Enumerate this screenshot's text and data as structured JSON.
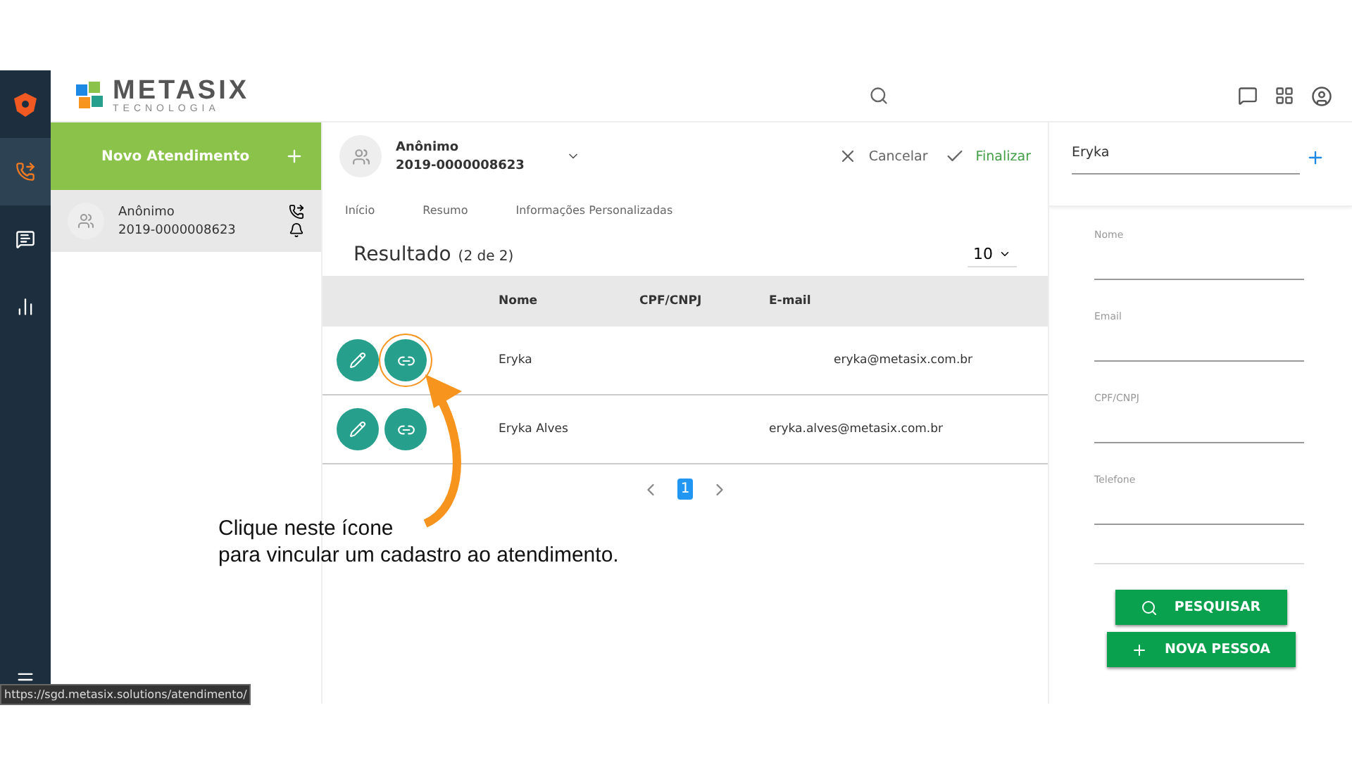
{
  "rail": {
    "items": [
      {
        "kind": "phone",
        "selected": true
      },
      {
        "kind": "chat",
        "selected": false
      },
      {
        "kind": "chart",
        "selected": false
      }
    ]
  },
  "logo": {
    "name": "METASIX",
    "tagline": "TECNOLOGIA"
  },
  "new_button": {
    "label": "Novo Atendimento"
  },
  "sessions": [
    {
      "name": "Anônimo",
      "protocol": "2019-0000008623",
      "selected": true
    }
  ],
  "current": {
    "name": "Anônimo",
    "protocol": "2019-0000008623",
    "cancel": "Cancelar",
    "finish": "Finalizar"
  },
  "tabs": [
    {
      "label": "Início",
      "selected": false
    },
    {
      "label": "Resumo",
      "selected": false
    },
    {
      "label": "Informações Personalizadas",
      "selected": false
    }
  ],
  "results": {
    "title": "Resultado",
    "count": "(2 de 2)",
    "page_size": "10"
  },
  "table": {
    "columns": [
      "Nome",
      "CPF/CNPJ",
      "E-mail"
    ],
    "rows": [
      {
        "name": "Eryka",
        "cpf": "",
        "email": "eryka@metasix.com.br",
        "highlighted": true
      },
      {
        "name": "Eryka Alves",
        "cpf": "",
        "email": "eryka.alves@metasix.com.br",
        "highlighted": false
      }
    ]
  },
  "pagination": {
    "pages": [
      {
        "label": "1",
        "selected": true
      }
    ]
  },
  "annotation": {
    "text": "Clique neste ícone\npara vincular um cadastro ao atendimento."
  },
  "search_panel": {
    "query": "Eryka",
    "fields": [
      {
        "label": "Nome"
      },
      {
        "label": "Email"
      },
      {
        "label": "CPF/CNPJ"
      },
      {
        "label": "Telefone"
      }
    ],
    "search_button": "PESQUISAR",
    "new_button": "NOVA PESSOA"
  },
  "status_url": "https://sgd.metasix.solutions/atendimento/"
}
